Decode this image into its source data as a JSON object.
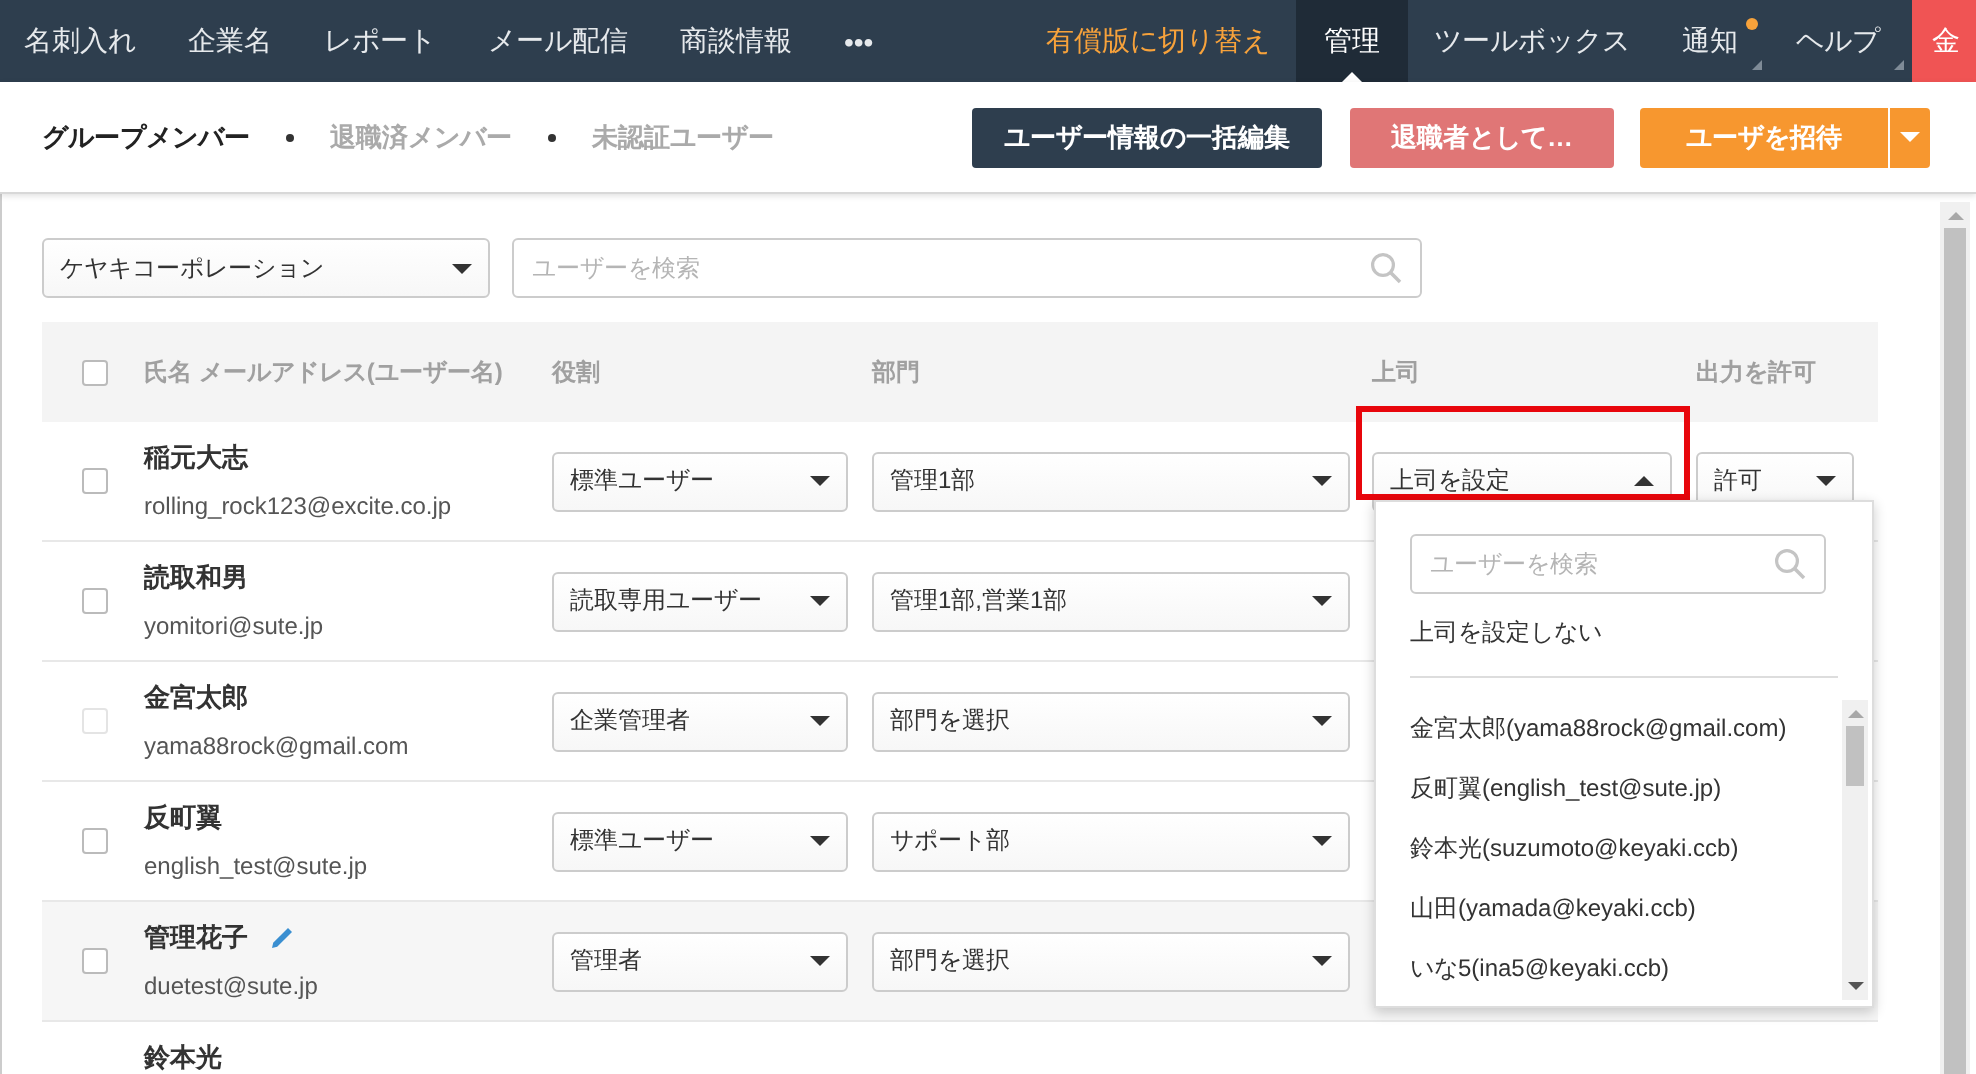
{
  "nav": {
    "items": [
      {
        "label": "名刺入れ",
        "selected": false
      },
      {
        "label": "企業名",
        "selected": false
      },
      {
        "label": "レポート",
        "selected": false
      },
      {
        "label": "メール配信",
        "selected": false
      },
      {
        "label": "商談情報",
        "selected": false
      },
      {
        "label": "•••",
        "selected": false
      }
    ],
    "right_items": [
      {
        "label": "有償版に切り替え",
        "kind": "upgrade",
        "selected": false
      },
      {
        "label": "管理",
        "kind": "link",
        "selected": true
      },
      {
        "label": "ツールボックス",
        "kind": "link",
        "selected": false
      },
      {
        "label": "通知",
        "kind": "menu",
        "selected": false,
        "badge": true
      },
      {
        "label": "ヘルプ",
        "kind": "menu",
        "selected": false,
        "badge": false
      },
      {
        "label": "金",
        "kind": "avatar",
        "selected": false
      }
    ]
  },
  "member_tabs": [
    {
      "label": "グループメンバー",
      "selected": true
    },
    {
      "label": "退職済メンバー",
      "selected": false
    },
    {
      "label": "未認証ユーザー",
      "selected": false
    }
  ],
  "actions": [
    {
      "label": "ユーザー情報の一括編集",
      "kind": "primary",
      "disabled": false
    },
    {
      "label": "退職者として…",
      "kind": "danger",
      "disabled": true
    },
    {
      "label": "ユーザを招待",
      "kind": "accent",
      "disabled": false,
      "split": true
    }
  ],
  "filters": {
    "company": "ケヤキコーポレーション",
    "search_placeholder": "ユーザーを検索"
  },
  "table": {
    "header_checked": false,
    "columns": [
      "氏名 メールアドレス(ユーザー名)",
      "役割",
      "部門",
      "上司",
      "出力を許可"
    ],
    "rows": [
      {
        "name": "稲元大志",
        "email": "rolling_rock123@excite.co.jp",
        "checked": false,
        "disabled": false,
        "role": "標準ユーザー",
        "department": "管理1部",
        "boss": "上司を設定",
        "boss_open": true,
        "boss_framed": true,
        "permission": "許可"
      },
      {
        "name": "読取和男",
        "email": "yomitori@sute.jp",
        "checked": false,
        "disabled": false,
        "role": "読取専用ユーザー",
        "department": "管理1部,営業1部"
      },
      {
        "name": "金宮太郎",
        "email": "yama88rock@gmail.com",
        "checked": false,
        "disabled": true,
        "role": "企業管理者",
        "department": "部門を選択"
      },
      {
        "name": "反町翼",
        "email": "english_test@sute.jp",
        "checked": false,
        "disabled": false,
        "role": "標準ユーザー",
        "department": "サポート部"
      },
      {
        "name": "管理花子",
        "email": "duetest@sute.jp",
        "checked": false,
        "disabled": false,
        "highlighted": true,
        "edit_icon": true,
        "role": "管理者",
        "department": "部門を選択"
      },
      {
        "name": "鈴本光"
      }
    ]
  },
  "boss_menu": {
    "search_placeholder": "ユーザーを検索",
    "none_option": "上司を設定しない",
    "options": [
      "金宮太郎(yama88rock@gmail.com)",
      "反町翼(english_test@sute.jp)",
      "鈴本光(suzumoto@keyaki.ccb)",
      "山田(yamada@keyaki.ccb)",
      "いな5(ina5@keyaki.ccb)"
    ]
  }
}
